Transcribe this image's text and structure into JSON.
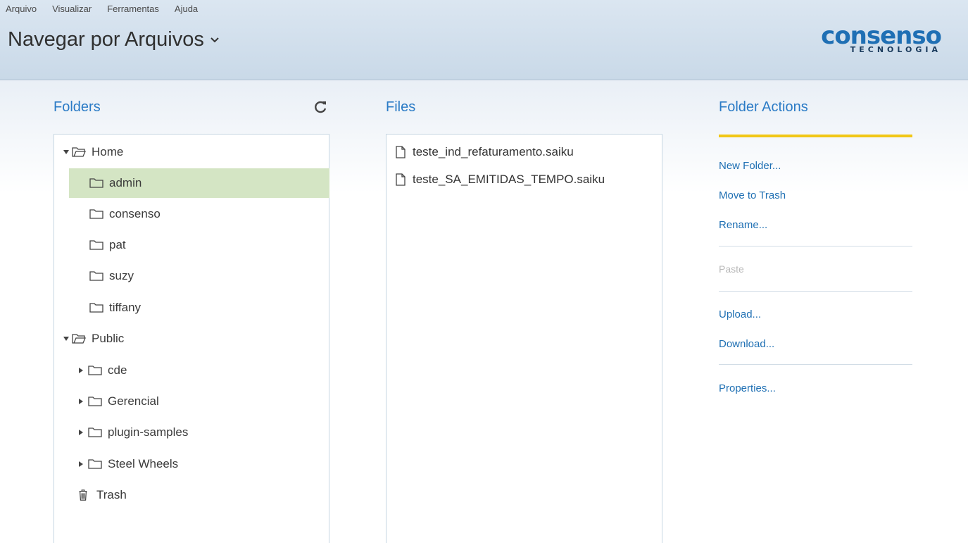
{
  "menu": [
    "Arquivo",
    "Visualizar",
    "Ferramentas",
    "Ajuda"
  ],
  "title": "Navegar por Arquivos",
  "logo": {
    "brand": "consenso",
    "sub": "TECNOLOGIA"
  },
  "folders": {
    "title": "Folders",
    "items": [
      {
        "label": "Home",
        "icon": "folder-open-icon",
        "expanded": true
      },
      {
        "label": "admin",
        "icon": "folder-icon",
        "selected": true
      },
      {
        "label": "consenso",
        "icon": "folder-icon"
      },
      {
        "label": "pat",
        "icon": "folder-icon"
      },
      {
        "label": "suzy",
        "icon": "folder-icon"
      },
      {
        "label": "tiffany",
        "icon": "folder-icon"
      },
      {
        "label": "Public",
        "icon": "folder-open-icon",
        "expanded": true
      },
      {
        "label": "cde",
        "icon": "folder-icon"
      },
      {
        "label": "Gerencial",
        "icon": "folder-icon"
      },
      {
        "label": "plugin-samples",
        "icon": "folder-icon"
      },
      {
        "label": "Steel Wheels",
        "icon": "folder-icon"
      },
      {
        "label": "Trash",
        "icon": "trash-icon"
      }
    ]
  },
  "files": {
    "title": "Files",
    "items": [
      "teste_ind_refaturamento.saiku",
      "teste_SA_EMITIDAS_TEMPO.saiku"
    ]
  },
  "actions": {
    "title": "Folder Actions",
    "new_folder": "New Folder...",
    "move_to_trash": "Move to Trash",
    "rename": "Rename...",
    "paste": "Paste",
    "upload": "Upload...",
    "download": "Download...",
    "properties": "Properties..."
  },
  "colors": {
    "accent": "#2b7bc6",
    "selected": "#d4e5c4",
    "highlight_bar": "#f1c716"
  }
}
